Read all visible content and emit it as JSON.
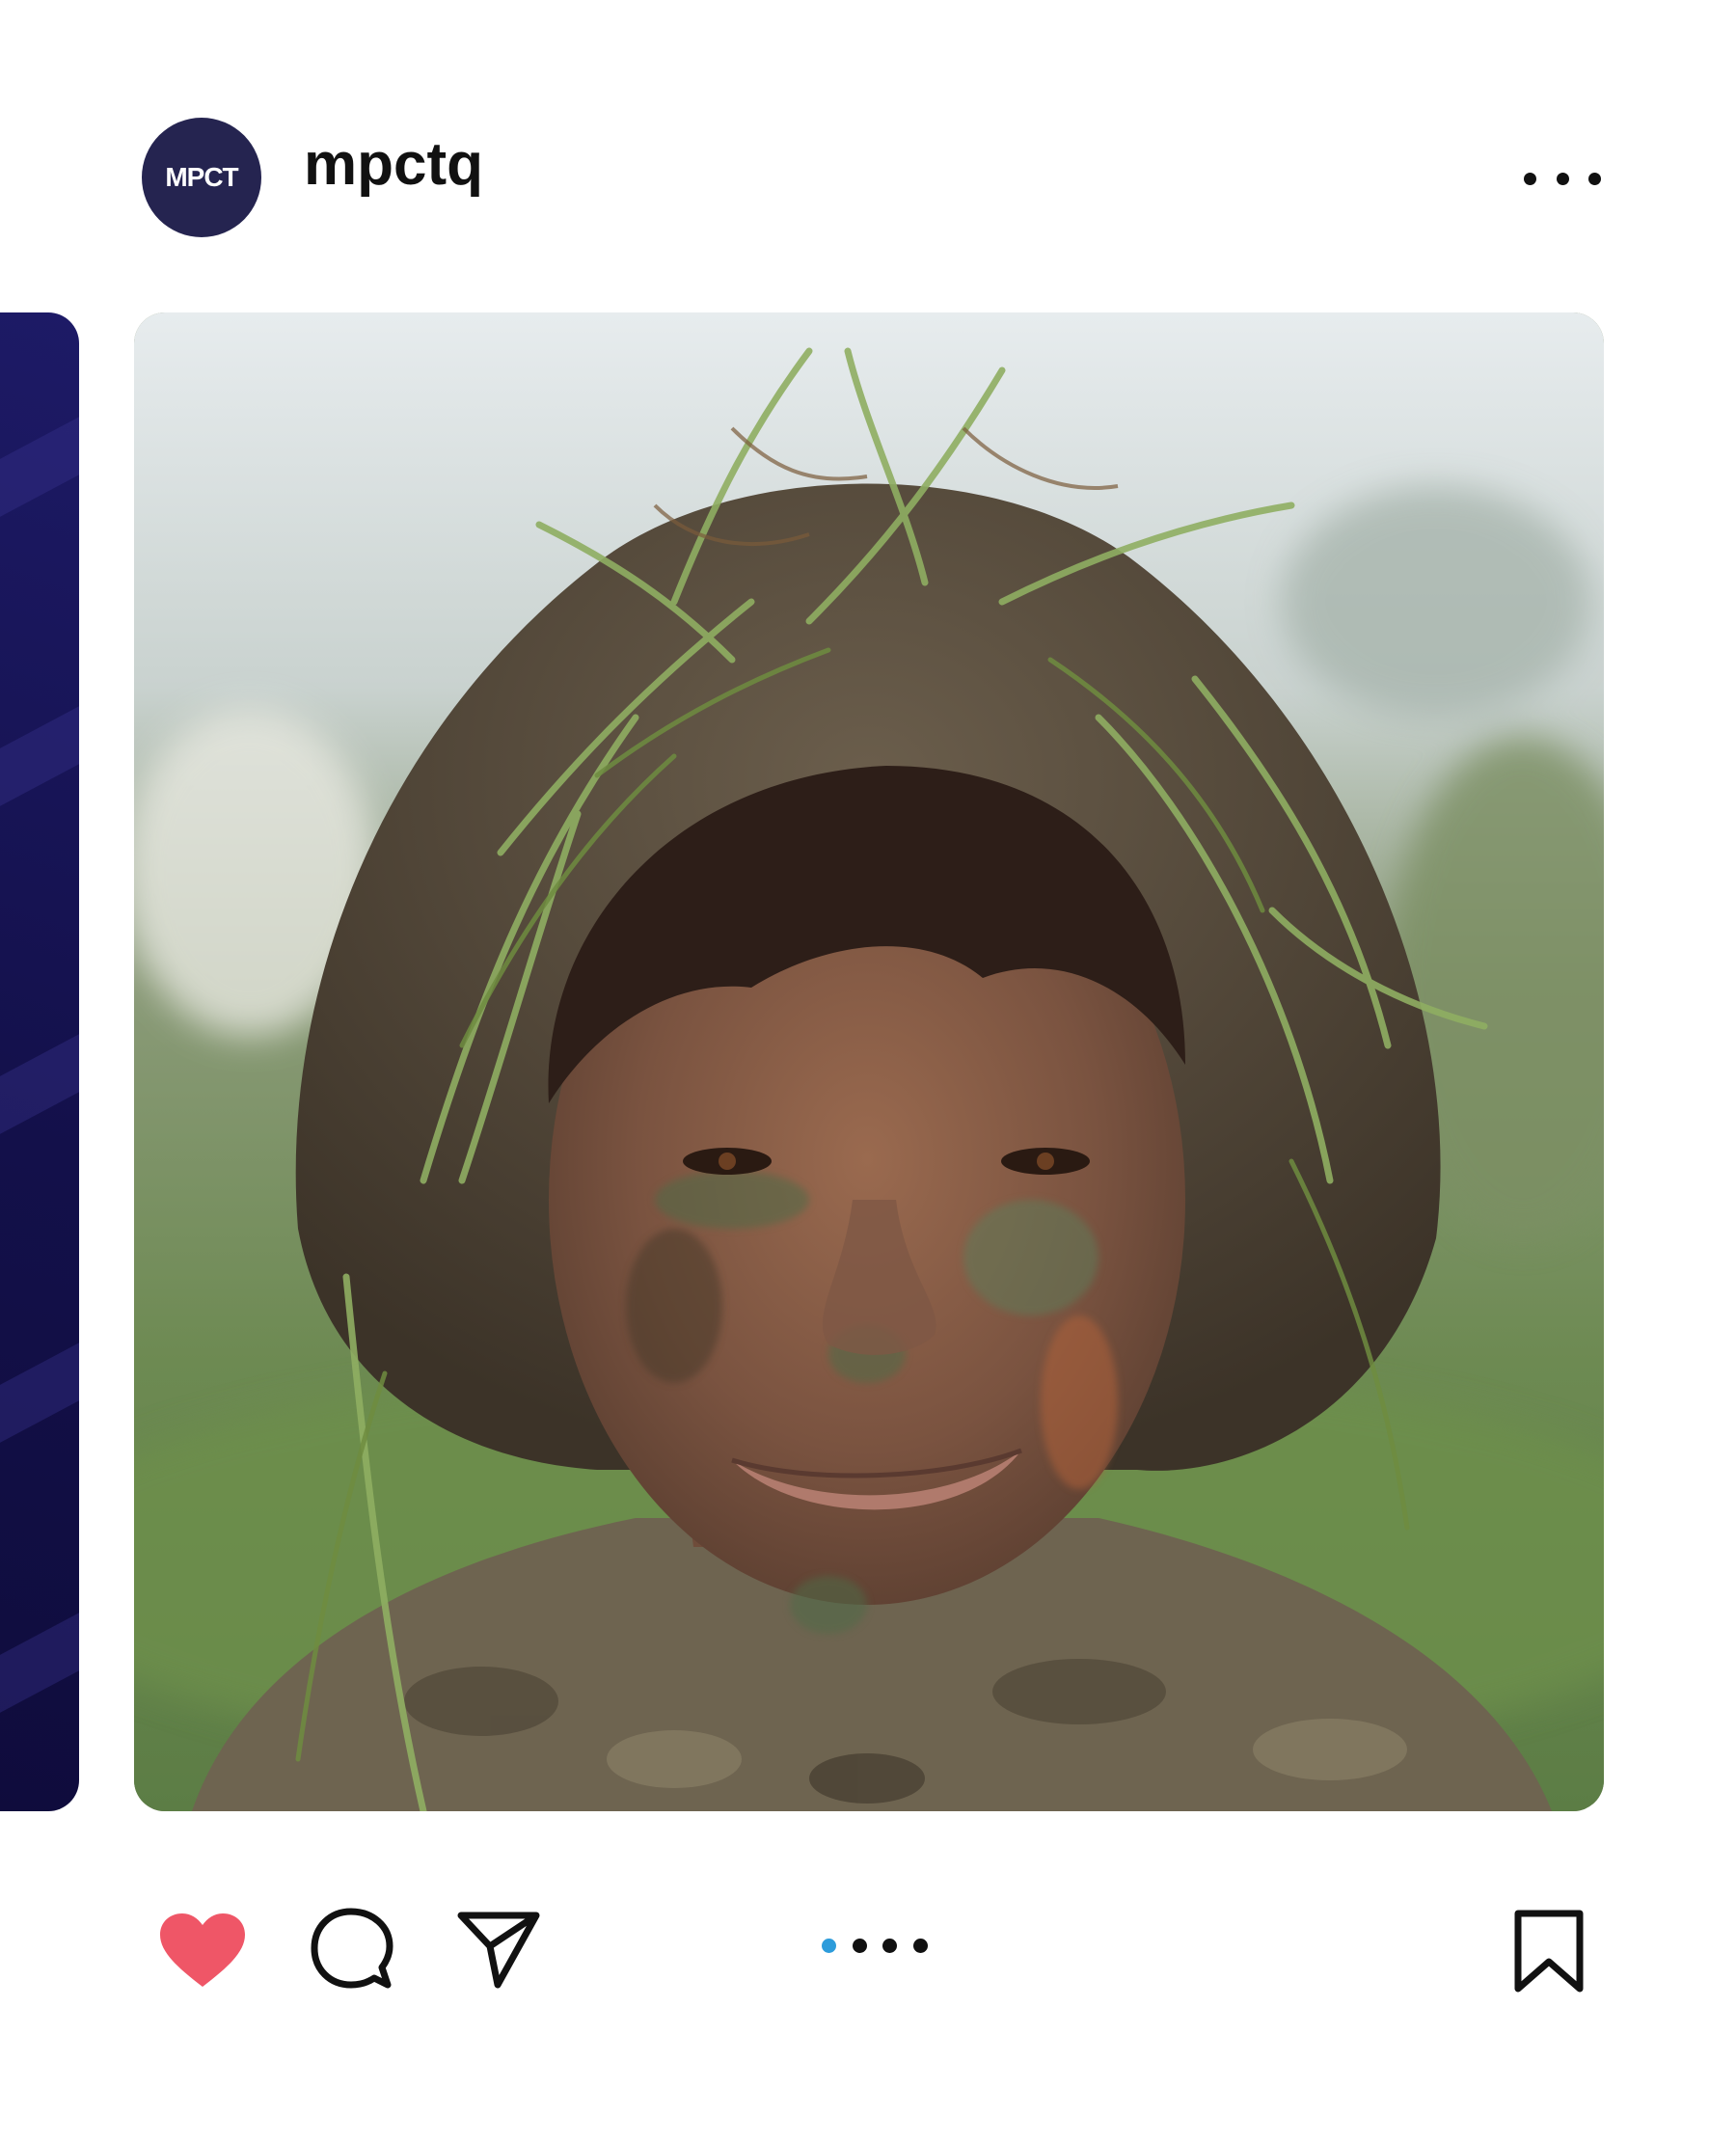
{
  "post": {
    "avatar_text": "MPCT",
    "username": "mpctq",
    "more_icon": "ellipsis-icon",
    "photo_subject": "camouflaged-cadet-photo",
    "carousel": {
      "total": 4,
      "active_index": 0
    }
  },
  "actions": {
    "like_icon": "heart-icon",
    "liked": true,
    "comment_icon": "comment-icon",
    "share_icon": "send-icon",
    "save_icon": "bookmark-icon"
  },
  "colors": {
    "avatar_bg": "#252450",
    "like_red": "#ef5667",
    "active_dot": "#2d9cdb",
    "prev_slide_navy": "#13104a"
  }
}
